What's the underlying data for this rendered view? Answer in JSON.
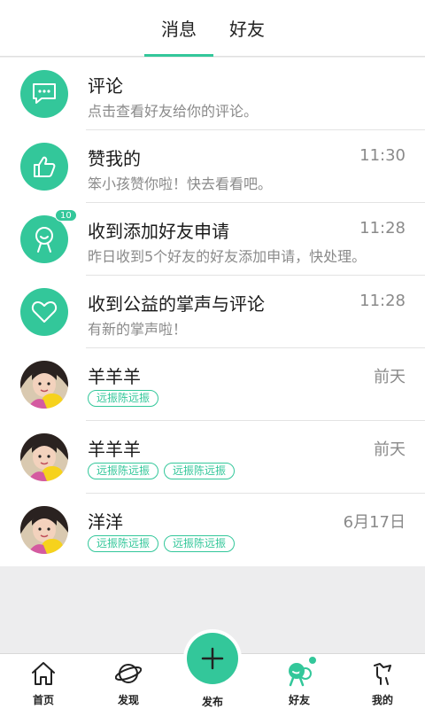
{
  "tabs": [
    {
      "label": "消息",
      "active": true
    },
    {
      "label": "好友",
      "active": false
    }
  ],
  "accent_color": "#33c79a",
  "messages": [
    {
      "icon": "comment-bubble-icon",
      "title": "评论",
      "subtitle": "点击查看好友给你的评论。",
      "time": ""
    },
    {
      "icon": "thumbs-up-icon",
      "title": "赞我的",
      "subtitle": "笨小孩赞你啦！快去看看吧。",
      "time": "11:30"
    },
    {
      "icon": "person-add-icon",
      "title": "收到添加好友申请",
      "subtitle": "昨日收到5个好友的好友添加申请，快处理。",
      "time": "11:28",
      "badge": "10"
    },
    {
      "icon": "heart-icon",
      "title": "收到公益的掌声与评论",
      "subtitle": "有新的掌声啦！",
      "time": "11:28"
    }
  ],
  "friends": [
    {
      "name": "羊羊羊",
      "time": "前天",
      "tags": [
        "远振陈远振"
      ]
    },
    {
      "name": "羊羊羊",
      "time": "前天",
      "tags": [
        "远振陈远振",
        "远振陈远振"
      ]
    },
    {
      "name": "洋洋",
      "time": "6月17日",
      "tags": [
        "远振陈远振",
        "远振陈远振"
      ]
    }
  ],
  "bottom_nav": [
    {
      "label": "首页",
      "icon": "home-icon"
    },
    {
      "label": "发现",
      "icon": "planet-icon"
    },
    {
      "label": "发布",
      "icon": "plus-icon"
    },
    {
      "label": "好友",
      "icon": "friends-icon",
      "dot": true
    },
    {
      "label": "我的",
      "icon": "profile-icon"
    }
  ]
}
